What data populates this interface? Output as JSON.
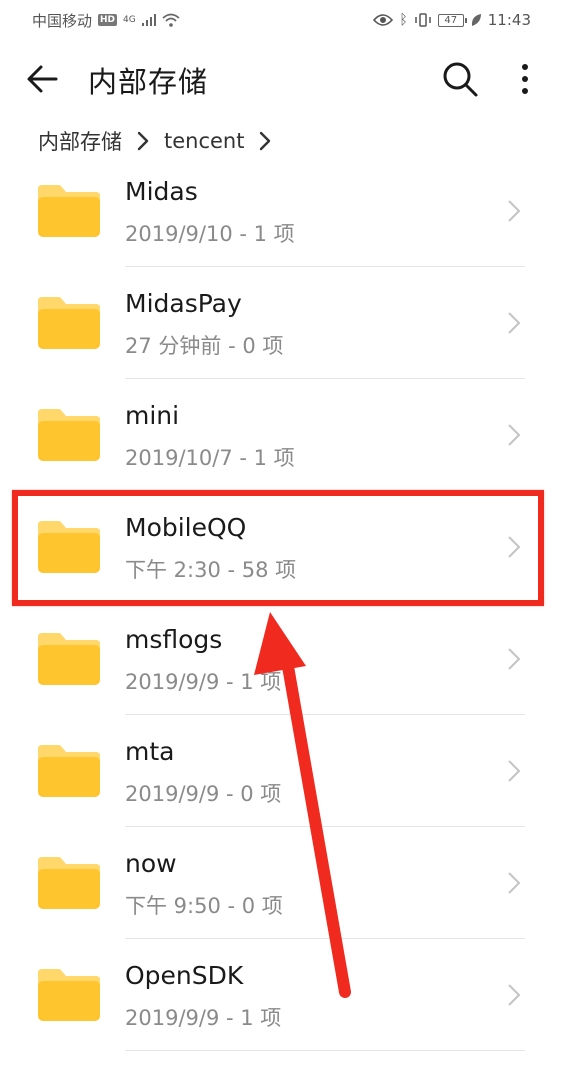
{
  "status_bar": {
    "carrier": "中国移动",
    "hd": "HD",
    "network": "4G",
    "battery": "47",
    "time": "11:43"
  },
  "header": {
    "title": "内部存储"
  },
  "breadcrumb": [
    "内部存储",
    "tencent"
  ],
  "files": [
    {
      "name": "Midas",
      "meta": "2019/9/10 - 1 项"
    },
    {
      "name": "MidasPay",
      "meta": "27 分钟前 - 0 项"
    },
    {
      "name": "mini",
      "meta": "2019/10/7 - 1 项"
    },
    {
      "name": "MobileQQ",
      "meta": "下午 2:30 - 58 项"
    },
    {
      "name": "msflogs",
      "meta": "2019/9/9 - 1 项"
    },
    {
      "name": "mta",
      "meta": "2019/9/9 - 0 项"
    },
    {
      "name": "now",
      "meta": "下午 9:50 - 0 项"
    },
    {
      "name": "OpenSDK",
      "meta": "2019/9/9 - 1 项"
    }
  ],
  "colors": {
    "folder": "#FFC52E",
    "folder_tab": "#FFD76A",
    "annotation": "#F02A1E"
  },
  "icons": {
    "back": "arrow-left-icon",
    "search": "search-icon",
    "more": "more-vertical-icon",
    "folder": "folder-icon",
    "chevron": "chevron-right-icon"
  }
}
